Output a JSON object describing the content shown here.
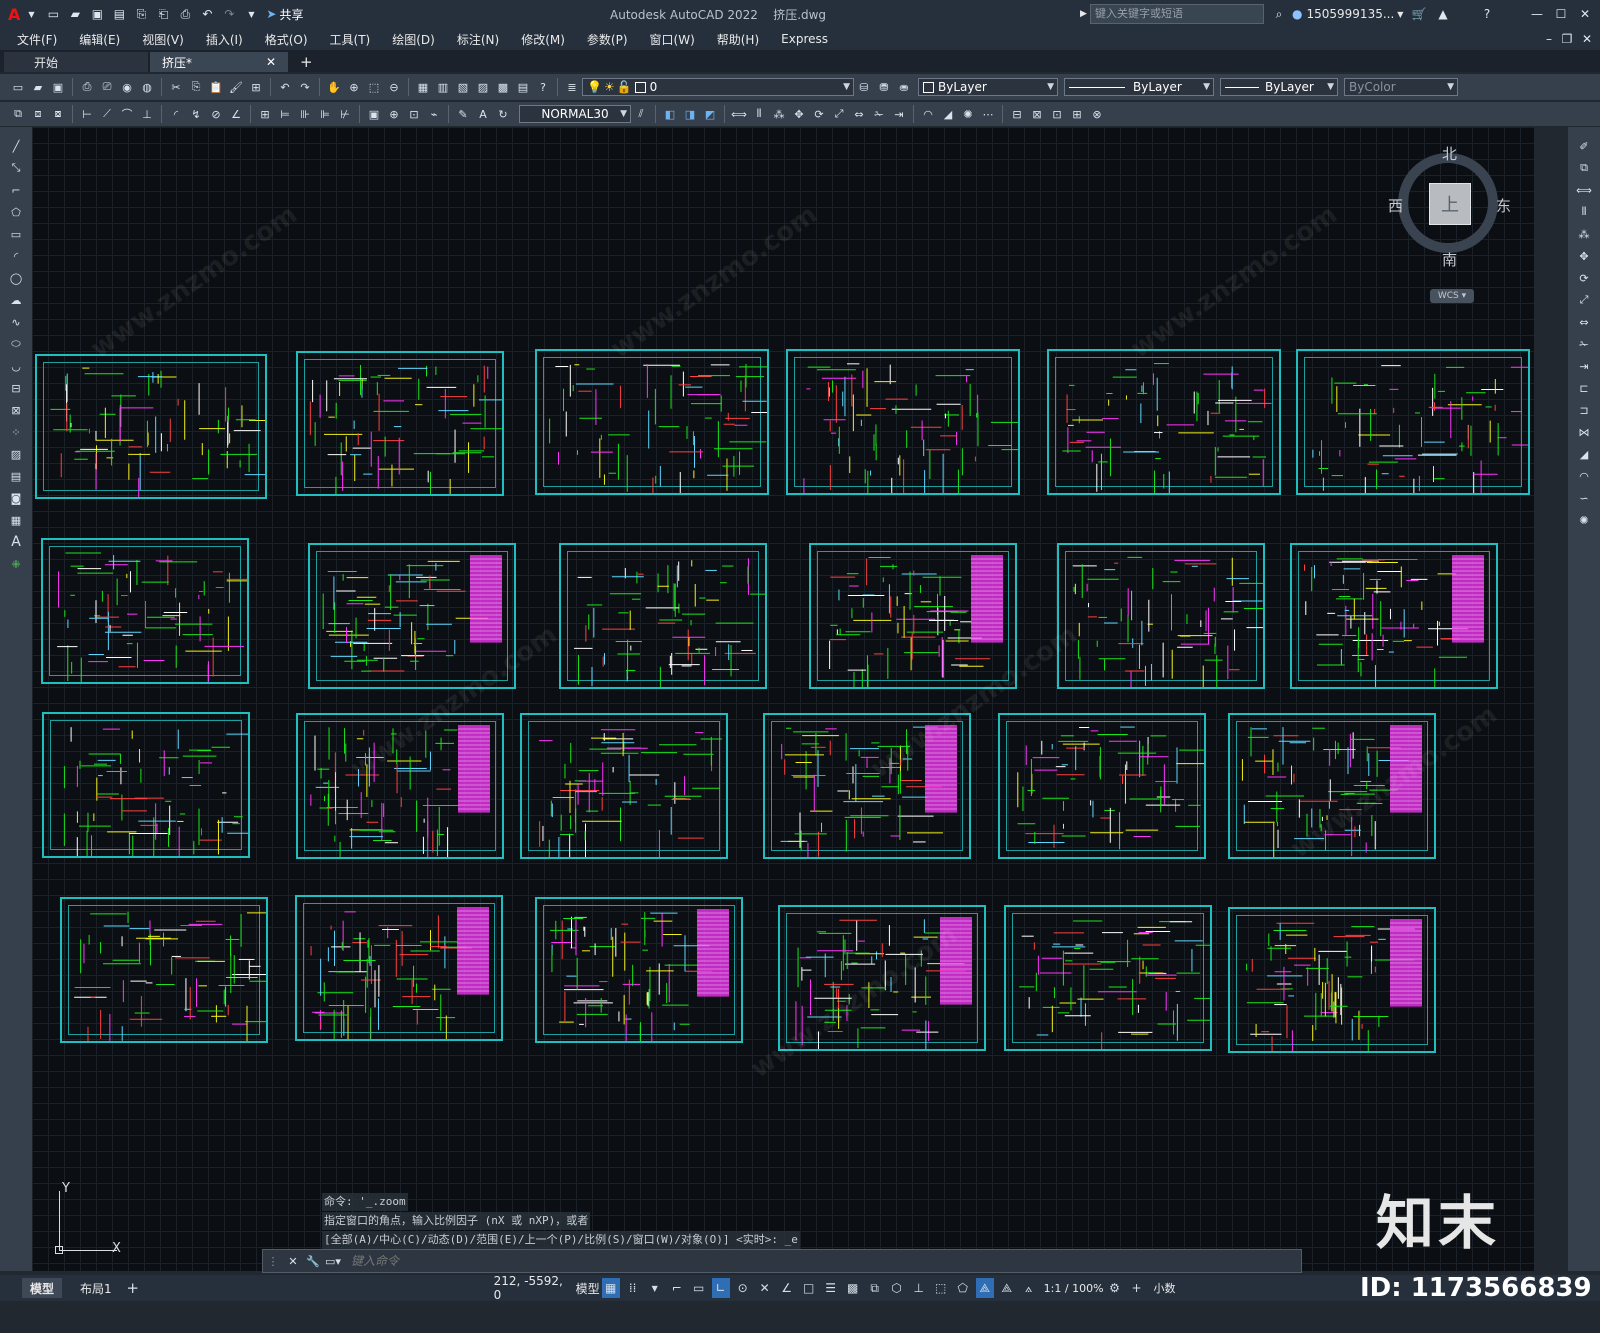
{
  "title_bar": {
    "app_title": "Autodesk AutoCAD 2022",
    "file_title": "挤压.dwg",
    "share_label": "共享",
    "search_placeholder": "键入关键字或短语",
    "user_name": "1505999135..."
  },
  "menu": [
    "文件(F)",
    "编辑(E)",
    "视图(V)",
    "插入(I)",
    "格式(O)",
    "工具(T)",
    "绘图(D)",
    "标注(N)",
    "修改(M)",
    "参数(P)",
    "窗口(W)",
    "帮助(H)",
    "Express"
  ],
  "tabs": {
    "start": "开始",
    "active": "挤压*"
  },
  "toolbar": {
    "layer_value": "0",
    "color_value": "ByLayer",
    "linetype_value": "ByLayer",
    "lineweight_value": "ByLayer",
    "plotstyle_value": "ByColor",
    "dimstyle_value": "NORMAL30"
  },
  "viewcube": {
    "north": "北",
    "south": "南",
    "west": "西",
    "east": "东",
    "face": "上",
    "wcs": "WCS"
  },
  "ucs": {
    "y_label": "Y",
    "x_label": "X"
  },
  "command": {
    "history": [
      "命令: '_.zoom",
      "指定窗口的角点，输入比例因子 (nX 或 nXP)，或者",
      "[全部(A)/中心(C)/动态(D)/范围(E)/上一个(P)/比例(S)/窗口(W)/对象(O)] <实时>: _e"
    ],
    "placeholder": "键入命令"
  },
  "status": {
    "model_tab": "模型",
    "layout_tab": "布局1",
    "coords": "212, -5592, 0",
    "model_label": "模型",
    "scale": "1:1 / 100%",
    "units": "小数"
  },
  "watermark": {
    "brand": "知末",
    "id_text": "ID: 1173566839",
    "url": "www.znzmo.com"
  },
  "colors": {
    "accent_cyan": "#1fbfbf",
    "green": "#19e619",
    "magenta": "#ff35ff",
    "yellow": "#f2f21a"
  }
}
